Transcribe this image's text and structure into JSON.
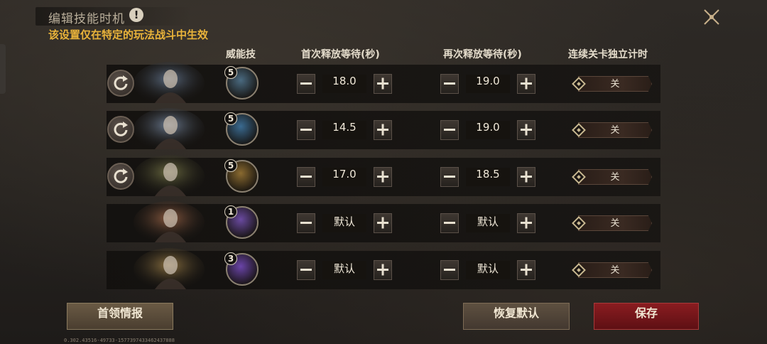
{
  "header": {
    "title": "编辑技能时机",
    "info_icon": "!",
    "subtitle": "该设置仅在特定的玩法战斗中生效",
    "close_icon": "close-x-icon"
  },
  "columns": {
    "skill": "威能技",
    "first_wait": "首次释放等待(秒)",
    "repeat_wait": "再次释放等待(秒)",
    "timer": "连续关卡独立计时"
  },
  "rows": [
    {
      "has_reset": true,
      "rank": "5",
      "skill_color": "#4a6a80",
      "first": "18.0",
      "repeat": "19.0",
      "timer": "关"
    },
    {
      "has_reset": true,
      "rank": "5",
      "skill_color": "#3a6a90",
      "first": "14.5",
      "repeat": "19.0",
      "timer": "关"
    },
    {
      "has_reset": true,
      "rank": "5",
      "skill_color": "#8a6a30",
      "first": "17.0",
      "repeat": "18.5",
      "timer": "关"
    },
    {
      "has_reset": false,
      "rank": "1",
      "skill_color": "#6a4aa0",
      "first": "默认",
      "repeat": "默认",
      "timer": "关"
    },
    {
      "has_reset": false,
      "rank": "3",
      "skill_color": "#6a44a8",
      "first": "默认",
      "repeat": "默认",
      "timer": "关"
    }
  ],
  "footer": {
    "boss_intel": "首领情报",
    "restore_default": "恢复默认",
    "save": "保存",
    "version": "0.302.43516-49733-1577397433462437888"
  },
  "colors": {
    "accent_gold": "#e9b33a",
    "save_red": "#8a1c20"
  }
}
